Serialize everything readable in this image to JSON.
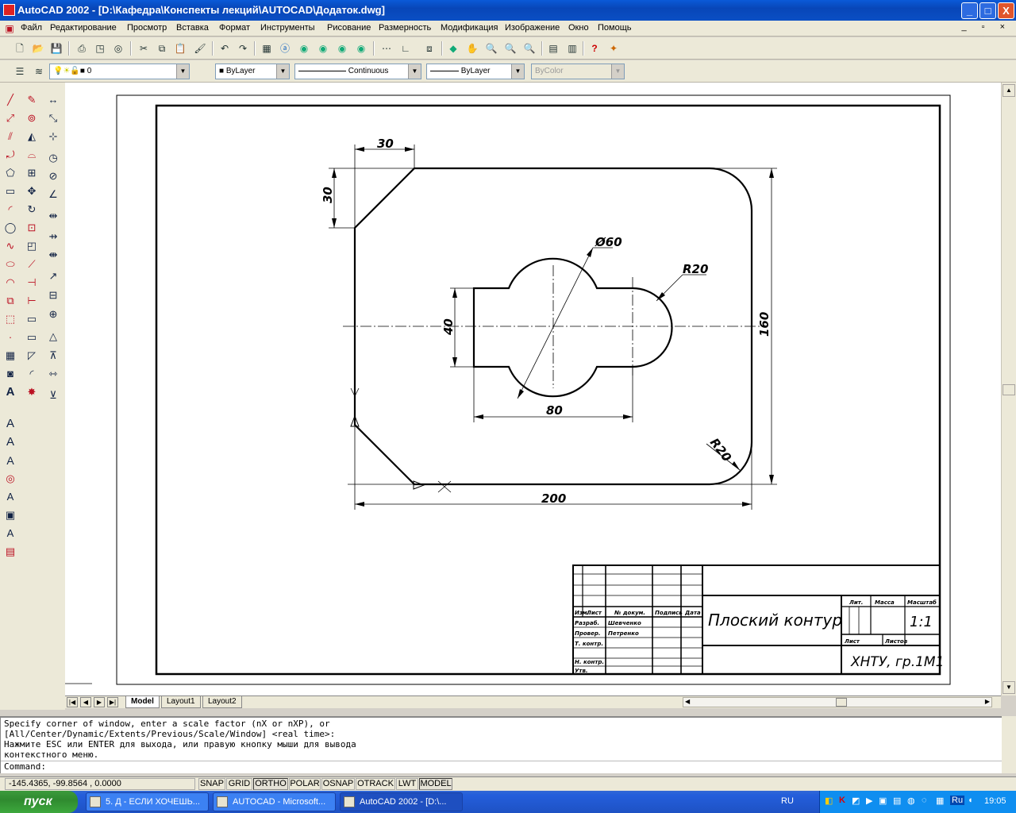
{
  "window": {
    "title": "AutoCAD 2002 - [D:\\Кафедра\\Конспекты лекций\\AUTOCAD\\Додаток.dwg]",
    "controls": [
      "_",
      "□",
      "X"
    ]
  },
  "menubar": {
    "items": [
      "Файл",
      "Редактирование",
      "Просмотр",
      "Вставка",
      "Формат",
      "Инструменты",
      "Рисование",
      "Размерность",
      "Модификация",
      "Изображение",
      "Окно",
      "Помощь"
    ]
  },
  "layers_toolbar": {
    "layer_value": "0",
    "color_value": "ByLayer",
    "linetype_value": "Continuous",
    "lineweight_value": "ByLayer",
    "plotstyle_value": "ByColor"
  },
  "drawing": {
    "dims": {
      "d30_top": "30",
      "d30_left": "30",
      "phi60": "Ø60",
      "r20_right": "R20",
      "d40": "40",
      "d160": "160",
      "d80": "80",
      "r20_corner": "R20",
      "d200": "200"
    },
    "title_block": {
      "name": "Плоский контур",
      "scale": "1:1",
      "org": "ХНТУ, гр.1М1",
      "hdr_lit": "Лит.",
      "hdr_mass": "Масса",
      "hdr_scale": "Масштаб",
      "hdr_sheet": "Лист",
      "hdr_sheets": "Листов",
      "rows": [
        "Изм.",
        "Лист",
        "№ докум.",
        "Подпись",
        "Дата",
        "Разраб.",
        "Провер.",
        "Т. контр.",
        "Н. контр.",
        "Утв."
      ],
      "names": [
        "Шевченко",
        "Петренко"
      ]
    }
  },
  "tabs": {
    "items": [
      "Model",
      "Layout1",
      "Layout2"
    ]
  },
  "command": {
    "lines": [
      "Specify corner of window, enter a scale factor (nX or nXP), or",
      "[All/Center/Dynamic/Extents/Previous/Scale/Window] <real time>:",
      "Нажмите ESC или ENTER для выхода, или правую кнопку мыши для вывода",
      "контекстного меню."
    ],
    "prompt": "Command:"
  },
  "status": {
    "coords": "-145.4365, -99.8564 , 0.0000",
    "buttons": [
      "SNAP",
      "GRID",
      "ORTHO",
      "POLAR",
      "OSNAP",
      "OTRACK",
      "LWT",
      "MODEL"
    ]
  },
  "taskbar": {
    "start": "пуск",
    "tasks": [
      "5. Д - ЕСЛИ ХОЧЕШЬ...",
      "AUTOCAD - Microsoft...",
      "AutoCAD 2002 - [D:\\..."
    ],
    "lang": "RU",
    "tray_lang": "Ru",
    "clock": "19:05"
  }
}
